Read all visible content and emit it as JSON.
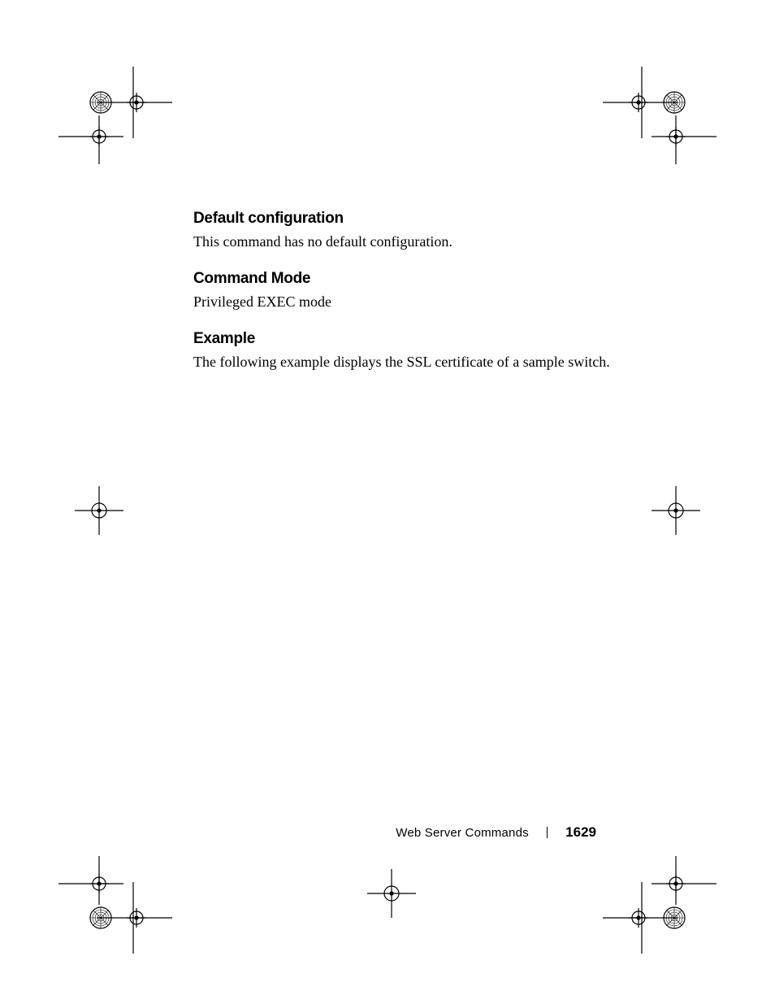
{
  "sections": [
    {
      "heading": "Default configuration",
      "body": "This command has no default configuration."
    },
    {
      "heading": "Command Mode",
      "body": "Privileged EXEC mode"
    },
    {
      "heading": "Example",
      "body": "The following example displays the SSL certificate of a sample switch."
    }
  ],
  "footer": {
    "chapter": "Web Server Commands",
    "page_number": "1629"
  }
}
